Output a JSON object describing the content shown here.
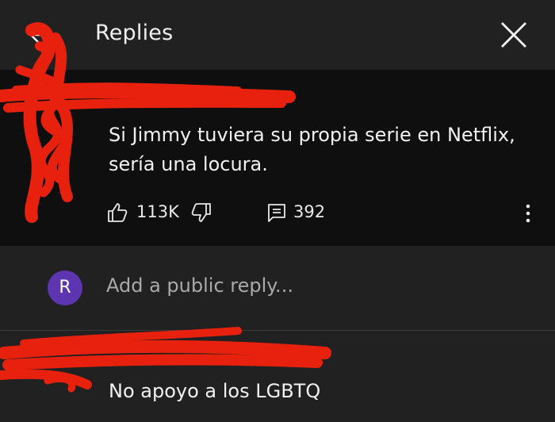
{
  "header": {
    "title": "Replies",
    "back_icon": "arrow-back-icon",
    "close_icon": "close-icon"
  },
  "comment": {
    "text": "Si Jimmy tuviera su propia serie en Netflix, sería una locura.",
    "likes": "113K",
    "replies": "392",
    "icons": [
      "thumb-up-icon",
      "thumb-down-icon",
      "comment-icon",
      "more-vert-icon"
    ]
  },
  "reply_box": {
    "avatar_letter": "R",
    "avatar_color": "#5e35b1",
    "placeholder": "Add a public reply..."
  },
  "reply": {
    "text": "No apoyo a los LGBTQ"
  },
  "colors": {
    "background": "#212121",
    "comment_background": "#0f0f0f",
    "redaction": "#e8210f"
  }
}
